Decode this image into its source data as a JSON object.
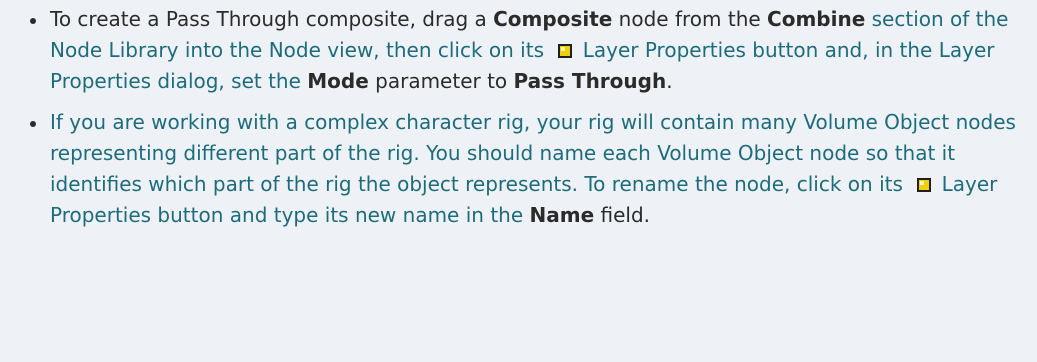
{
  "items": [
    {
      "segments": [
        {
          "text": "To create a Pass Through composite, drag a ",
          "style": "plain"
        },
        {
          "text": "Composite",
          "style": "bold"
        },
        {
          "text": " node from the ",
          "style": "plain"
        },
        {
          "text": "Combine",
          "style": "bold"
        },
        {
          "text": " section of the Node Library into the Node view, then click on its ",
          "style": "accent"
        },
        {
          "icon": "layer-properties-icon"
        },
        {
          "text": " Layer Properties button and, in the Layer Properties dialog, set the ",
          "style": "accent"
        },
        {
          "text": "Mode",
          "style": "bold"
        },
        {
          "text": " parameter to ",
          "style": "plain"
        },
        {
          "text": "Pass Through",
          "style": "bold"
        },
        {
          "text": ".",
          "style": "plain"
        }
      ]
    },
    {
      "segments": [
        {
          "text": "If you are working with a complex character rig, your rig will contain many Volume Object nodes representing different part of the rig. You should name each Volume Object node so that it identifies which part of the rig the object represents. To rename the node, click on its ",
          "style": "accent"
        },
        {
          "icon": "layer-properties-icon"
        },
        {
          "text": " Layer Properties button and type its new name in the ",
          "style": "accent"
        },
        {
          "text": "Name",
          "style": "bold"
        },
        {
          "text": " field.",
          "style": "plain"
        }
      ]
    }
  ]
}
